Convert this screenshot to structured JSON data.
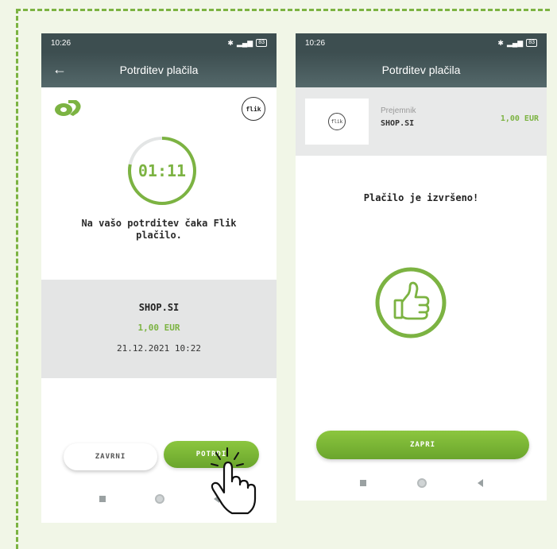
{
  "left_screen": {
    "status_time": "10:26",
    "status_battery": "83",
    "title": "Potrditev plačila",
    "flik_badge": "flik",
    "timer": "01:11",
    "message": "Na vašo potrditev čaka Flik plačilo.",
    "merchant": "SHOP.SI",
    "amount": "1,00 EUR",
    "datetime": "21.12.2021 10:22",
    "cancel_label": "ZAVRNI",
    "confirm_label": "POTRDI",
    "timer_progress": 0.78,
    "icons": [
      "back-arrow-icon",
      "brand-logo-icon",
      "flik-icon",
      "hand-pointer-icon"
    ]
  },
  "right_screen": {
    "status_time": "10:26",
    "status_battery": "83",
    "title": "Potrditev plačila",
    "flik_badge": "flik",
    "recipient_label": "Prejemnik",
    "recipient_name": "SHOP.SI",
    "amount": "1,00 EUR",
    "success_message": "Plačilo je izvršeno!",
    "close_label": "ZAPRI",
    "icons": [
      "flik-icon",
      "thumbs-up-icon"
    ]
  },
  "colors": {
    "accent": "#7cb342",
    "header": "#3d4e50",
    "background": "#f1f6e7",
    "panel": "#e4e5e5"
  }
}
